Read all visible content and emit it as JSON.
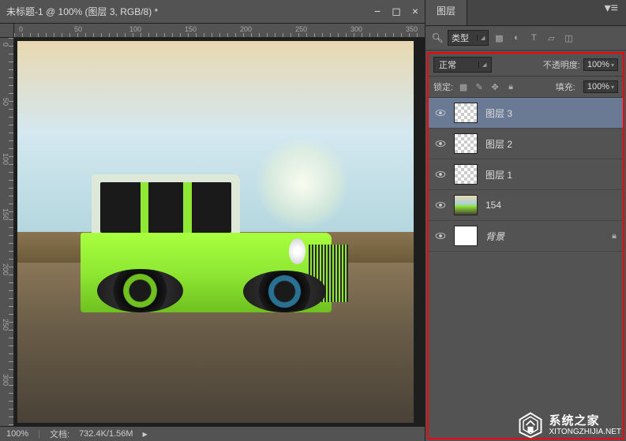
{
  "doc": {
    "title": "未标题-1 @ 100% (图层 3, RGB/8) *",
    "ruler_h": [
      "0",
      "50",
      "100",
      "150",
      "200",
      "250",
      "300",
      "350"
    ],
    "ruler_v": [
      "0",
      "50",
      "100",
      "150",
      "200",
      "250",
      "300"
    ]
  },
  "status": {
    "zoom": "100%",
    "doc_label": "文档:",
    "size": "732.4K/1.56M"
  },
  "panel": {
    "tab": "图层",
    "filter_type": "类型",
    "blend_mode": "正常",
    "opacity_label": "不透明度:",
    "opacity_value": "100%",
    "lock_label": "锁定:",
    "fill_label": "填充:",
    "fill_value": "100%"
  },
  "layers": [
    {
      "name": "图层 3",
      "thumb": "checker",
      "selected": true,
      "locked": false,
      "italic": false
    },
    {
      "name": "图层 2",
      "thumb": "checker",
      "selected": false,
      "locked": false,
      "italic": false
    },
    {
      "name": "图层 1",
      "thumb": "checker",
      "selected": false,
      "locked": false,
      "italic": false
    },
    {
      "name": "154",
      "thumb": "car",
      "selected": false,
      "locked": false,
      "italic": false
    },
    {
      "name": "背景",
      "thumb": "white",
      "selected": false,
      "locked": true,
      "italic": true
    }
  ],
  "watermark": {
    "cn": "系统之家",
    "en": "XITONGZHIJIA.NET"
  }
}
